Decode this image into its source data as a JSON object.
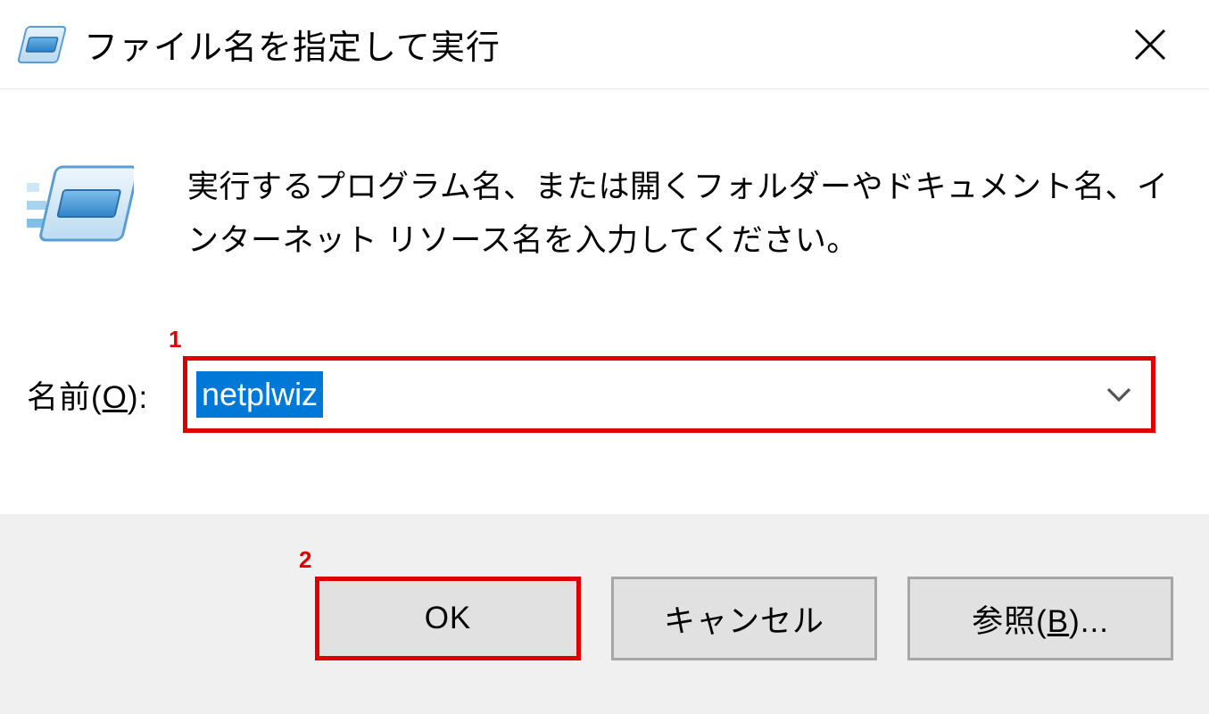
{
  "titlebar": {
    "title": "ファイル名を指定して実行"
  },
  "content": {
    "description": "実行するプログラム名、または開くフォルダーやドキュメント名、インターネット リソース名を入力してください。"
  },
  "input": {
    "label_prefix": "名前(",
    "label_hotkey": "O",
    "label_suffix": "):",
    "value": "netplwiz"
  },
  "buttons": {
    "ok": "OK",
    "cancel": "キャンセル",
    "browse_prefix": "参照(",
    "browse_hotkey": "B",
    "browse_suffix": ")..."
  },
  "callouts": {
    "one": "1",
    "two": "2"
  }
}
